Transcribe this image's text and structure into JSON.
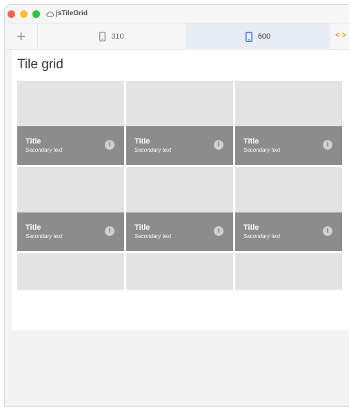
{
  "window": {
    "app_title": "jsTileGrid"
  },
  "tabbar": {
    "add_label": "+",
    "tabs": [
      {
        "label": "310",
        "icon": "phone-icon"
      },
      {
        "label": "600",
        "icon": "phone-icon",
        "active": true
      }
    ],
    "close_label": "×",
    "code_label": "< >"
  },
  "page": {
    "title": "Tile grid"
  },
  "tiles": [
    {
      "title": "Title",
      "subtitle": "Secondary text"
    },
    {
      "title": "Title",
      "subtitle": "Secondary text"
    },
    {
      "title": "Title",
      "subtitle": "Secondary text"
    },
    {
      "title": "Title",
      "subtitle": "Secondary text"
    },
    {
      "title": "Title",
      "subtitle": "Secondary text"
    },
    {
      "title": "Title",
      "subtitle": "Secondary text"
    }
  ],
  "info_glyph": "i",
  "colors": {
    "tile_bg": "#e3e3e3",
    "tile_bar": "#8c8c8c",
    "active_tab": "#e8edf5",
    "accent_phone": "#2f6fd6"
  }
}
